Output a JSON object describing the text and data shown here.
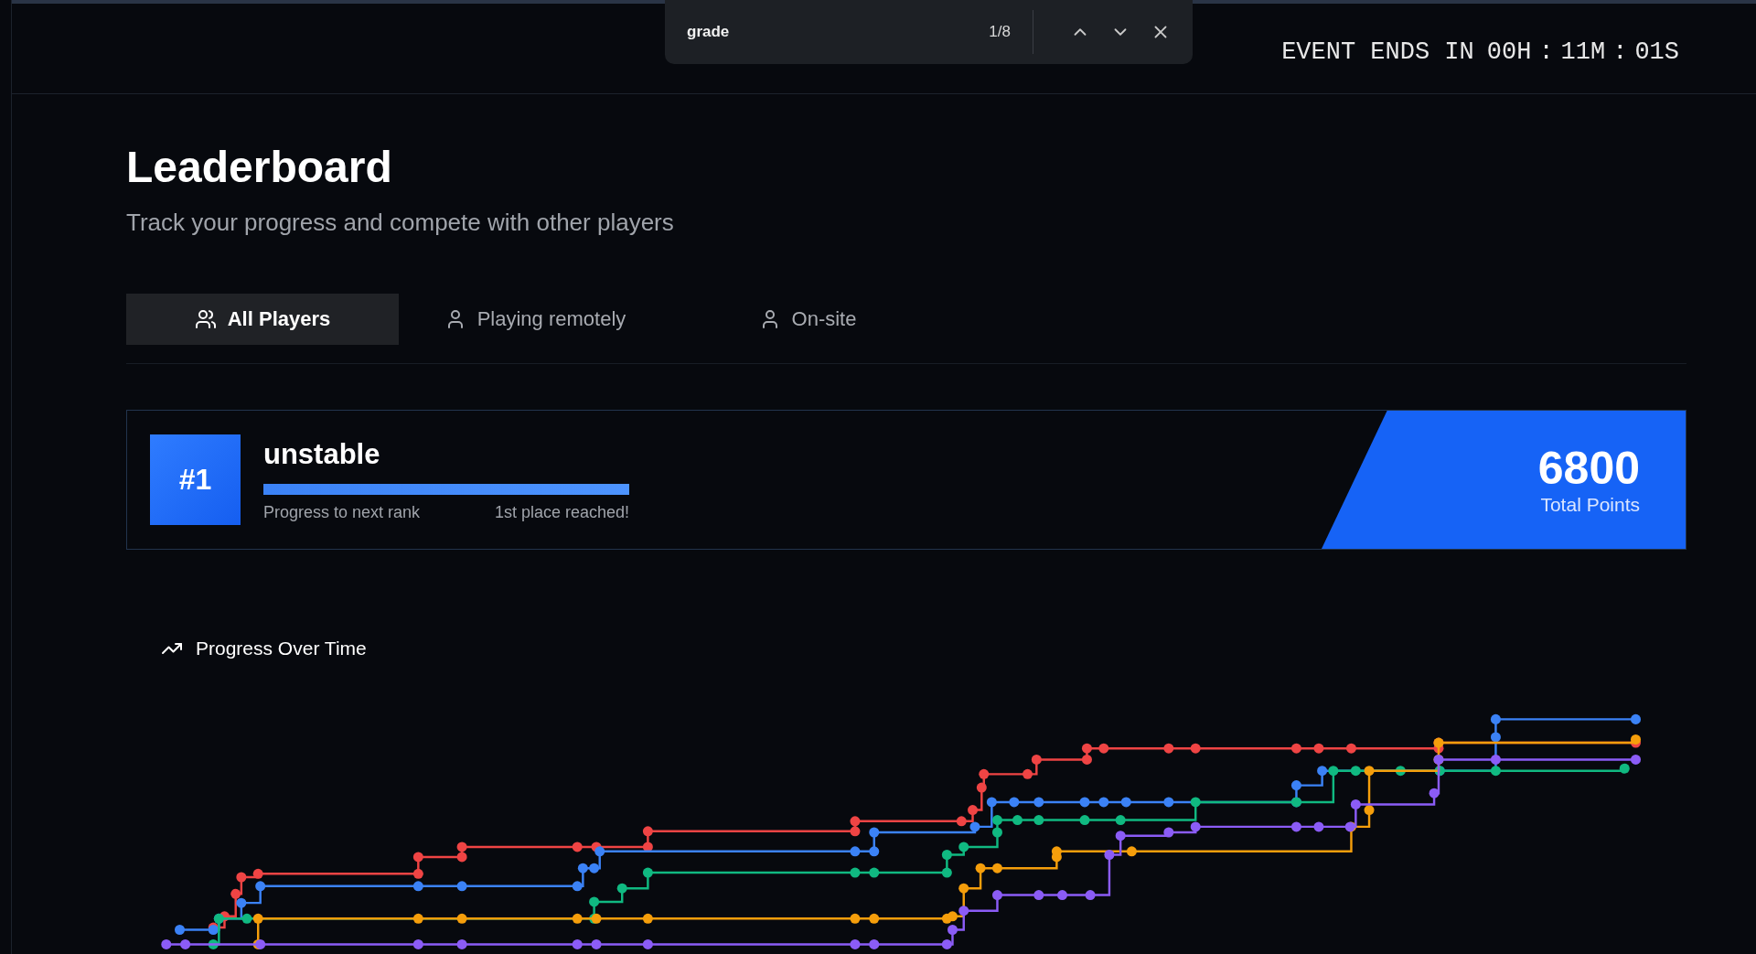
{
  "find_bar": {
    "query": "grade",
    "match_count": "1/8"
  },
  "timer": {
    "segments": [
      {
        "kind": "label",
        "text": "EVENT ENDS IN"
      },
      {
        "kind": "value",
        "text": "00H"
      },
      {
        "kind": "separator",
        "text": ":"
      },
      {
        "kind": "value",
        "text": "11M"
      },
      {
        "kind": "separator",
        "text": ":"
      },
      {
        "kind": "value",
        "text": "01S"
      }
    ]
  },
  "page": {
    "title": "Leaderboard",
    "subtitle": "Track your progress and compete with other players"
  },
  "tabs": [
    {
      "label": "All Players",
      "selected": true
    },
    {
      "label": "Playing remotely",
      "selected": false
    },
    {
      "label": "On-site",
      "selected": false
    }
  ],
  "player_card": {
    "rank": "#1",
    "name": "unstable",
    "level": 1,
    "progress_label": "Progress to next rank",
    "progress_status": "1st place reached!",
    "points": "6800",
    "points_label": "Total Points"
  },
  "chart": {
    "title": "Progress Over Time"
  }
}
